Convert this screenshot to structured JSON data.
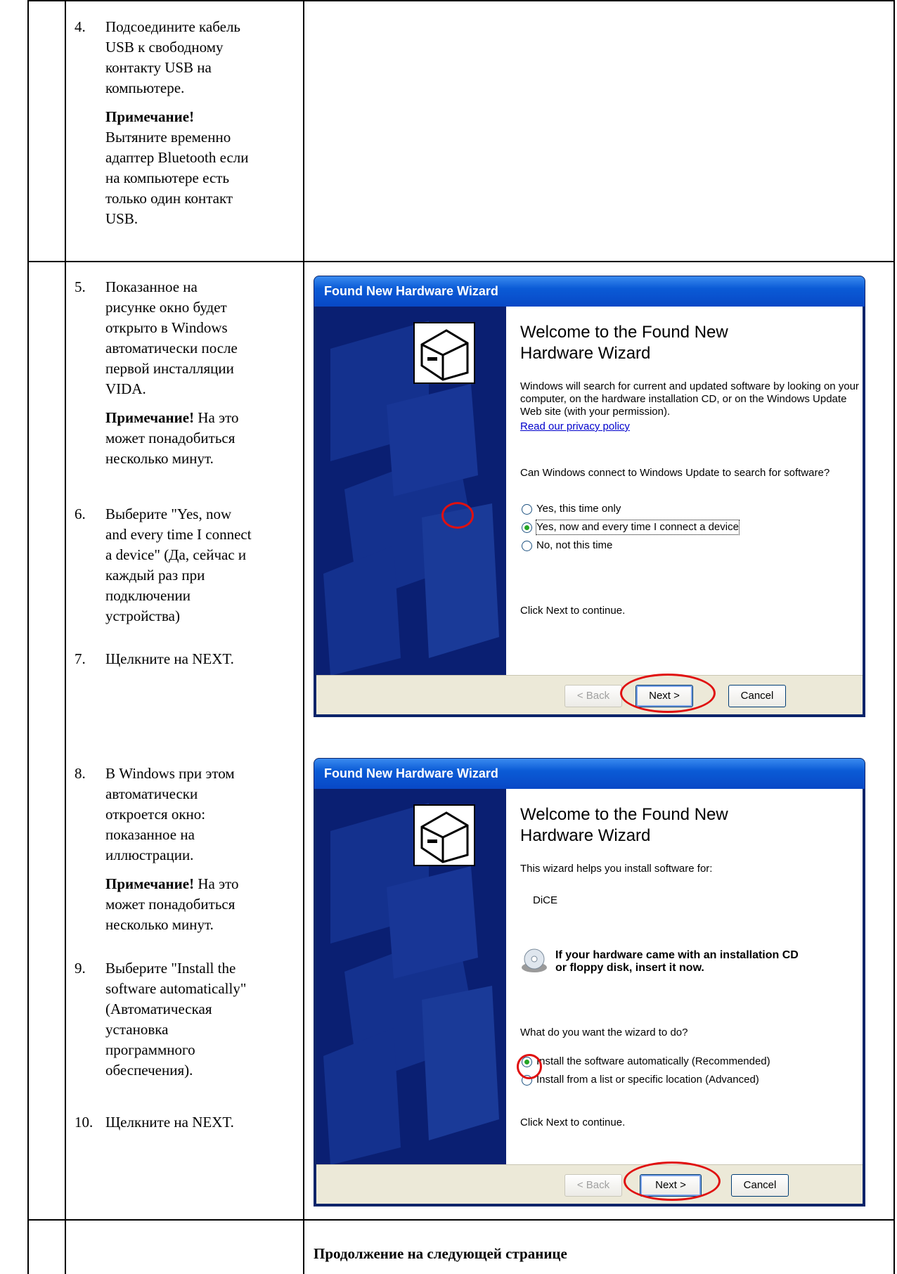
{
  "steps": [
    {
      "num": "4.",
      "lines": [
        "Подсоедините кабель",
        "USB к свободному",
        "контакту USB на",
        "компьютере."
      ],
      "note_label": "Примечание!",
      "note_lines": [
        "Вытяните временно",
        "адаптер Bluetooth если",
        "на компьютере есть",
        "только один контакт",
        "USB."
      ]
    },
    {
      "num": "5.",
      "lines": [
        "Показанное на",
        "рисунке окно будет",
        "открыто в Windows",
        "автоматически после",
        "первой инсталляции",
        "VIDA."
      ],
      "note_label": "Примечание!",
      "note_lines": [
        " На это",
        "может понадобиться",
        "несколько минут."
      ]
    },
    {
      "num": "6.",
      "lines": [
        "Выберите \"Yes, now",
        "and every time I connect",
        "a device\" (Да, сейчас и",
        "каждый раз при",
        "подключении",
        "устройства)"
      ]
    },
    {
      "num": "7.",
      "lines": [
        "Щелкните на NEXT."
      ]
    },
    {
      "num": "8.",
      "lines": [
        "В Windows при этом",
        "автоматически",
        "откроется окно:",
        "показанное на",
        "иллюстрации."
      ],
      "note_label": "Примечание!",
      "note_lines": [
        " На это",
        "может понадобиться",
        "несколько минут."
      ]
    },
    {
      "num": "9.",
      "lines": [
        "Выберите \"Install the",
        "software automatically\"",
        "(Автоматическая",
        "установка",
        "программного",
        "обеспечения)."
      ]
    },
    {
      "num": "10.",
      "lines": [
        "Щелкните на NEXT."
      ]
    }
  ],
  "wizard1": {
    "title": "Found New Hardware Wizard",
    "heading": [
      "Welcome to the Found New",
      "Hardware Wizard"
    ],
    "text": "Windows will search for current and updated software by looking on your computer, on the hardware installation CD, or on the Windows Update Web site (with your permission).",
    "link": "Read our privacy policy",
    "question": "Can Windows connect to Windows Update to search for software?",
    "options": [
      "Yes, this time only",
      "Yes, now and every time I connect a device",
      "No, not this time"
    ],
    "selected": 1,
    "footer_text": "Click Next to continue.",
    "back": "< Back",
    "next": "Next >",
    "cancel": "Cancel"
  },
  "wizard2": {
    "title": "Found New Hardware Wizard",
    "heading": [
      "Welcome to the Found New",
      "Hardware Wizard"
    ],
    "text": "This wizard helps you install software for:",
    "device": "DiCE",
    "cd_text": [
      "If your hardware came with an installation CD",
      "or floppy disk, insert it now."
    ],
    "question": "What do you want the wizard to do?",
    "options": [
      "Install the software automatically (Recommended)",
      "Install from a list or specific location (Advanced)"
    ],
    "selected": 0,
    "footer_text": "Click Next to continue.",
    "back": "< Back",
    "next": "Next >",
    "cancel": "Cancel"
  },
  "footer": "Продолжение на следующей странице"
}
